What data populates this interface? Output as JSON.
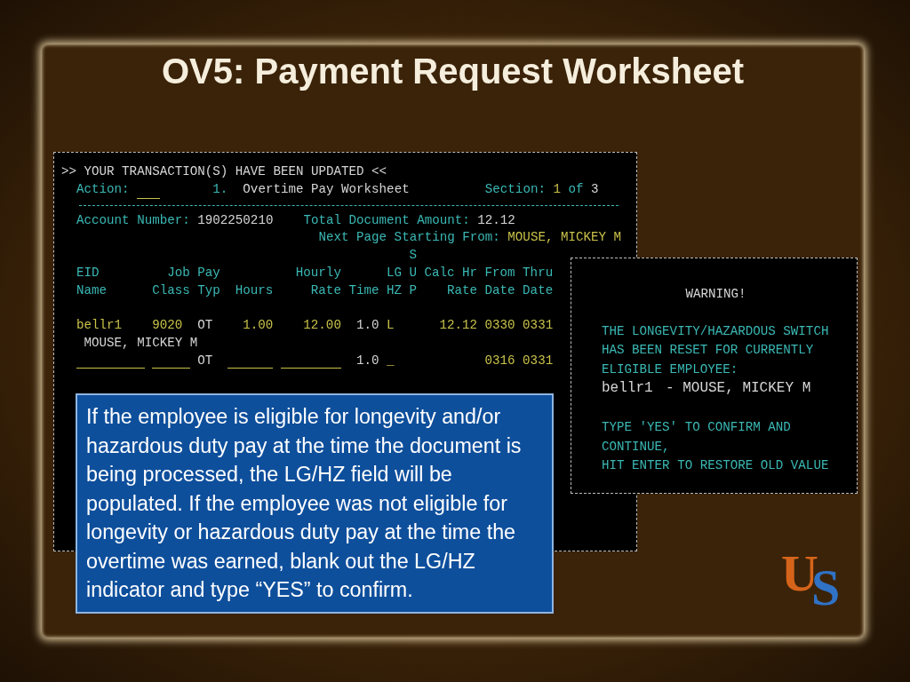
{
  "title": "OV5: Payment Request Worksheet",
  "terminal": {
    "banner": ">> YOUR TRANSACTION(S) HAVE BEEN UPDATED <<",
    "action": {
      "label": "Action:",
      "number": "1.",
      "screen": "Overtime Pay Worksheet",
      "section_label": "Section:",
      "section_current": "1",
      "section_of": "of",
      "section_total": "3"
    },
    "account": {
      "label": "Account Number:",
      "value": "1902250210"
    },
    "total": {
      "label": "Total Document Amount:",
      "value": "12.12"
    },
    "next_page": {
      "label": "Next Page Starting From:",
      "value": "MOUSE, MICKEY M"
    },
    "columns": [
      {
        "line_2": "EID",
        "line_3": "Name"
      },
      {
        "line_2": "Job",
        "line_3": "Class"
      },
      {
        "line_2": "Pay",
        "line_3": "Typ"
      },
      {
        "line_3": "Hours"
      },
      {
        "line_2": "Hourly",
        "line_3": "Rate"
      },
      {
        "line_3": "Time"
      },
      {
        "line_2": "LG",
        "line_3": "HZ"
      },
      {
        "line_1": "S",
        "line_2": "U",
        "line_3": "P"
      },
      {
        "line_2": "Calc Hr",
        "line_3": "Rate"
      },
      {
        "line_2": "From",
        "line_3": "Date"
      },
      {
        "line_2": "Thru",
        "line_3": "Date"
      }
    ],
    "rows": [
      {
        "cells": [
          {
            "kind": "input",
            "text": "bellr1"
          },
          {
            "kind": "input",
            "text": "9020"
          },
          {
            "kind": "value",
            "text": "OT"
          },
          {
            "kind": "input",
            "text": "1.00"
          },
          {
            "kind": "input",
            "text": "12.00"
          },
          {
            "kind": "value",
            "text": "1.0"
          },
          {
            "kind": "input",
            "text": "L"
          },
          {
            "kind": "blank"
          },
          {
            "kind": "input",
            "text": "12.12"
          },
          {
            "kind": "input",
            "text": "0330"
          },
          {
            "kind": "input",
            "text": "0331"
          }
        ],
        "name": "MOUSE, MICKEY M"
      },
      {
        "cells": [
          {
            "kind": "input"
          },
          {
            "kind": "input"
          },
          {
            "kind": "value",
            "text": "OT"
          },
          {
            "kind": "input"
          },
          {
            "kind": "input"
          },
          {
            "kind": "value",
            "text": "1.0"
          },
          {
            "kind": "input",
            "text": "_"
          },
          {
            "kind": "blank"
          },
          {
            "kind": "blank"
          },
          {
            "kind": "input",
            "text": "0316"
          },
          {
            "kind": "input",
            "text": "0331"
          }
        ]
      }
    ]
  },
  "warning": {
    "title": "WARNING!",
    "message": [
      "THE LONGEVITY/HAZARDOUS SWITCH",
      "HAS BEEN RESET FOR CURRENTLY",
      "ELIGIBLE EMPLOYEE:"
    ],
    "employee_id": "bellr1",
    "employee_name": "- MOUSE, MICKEY M",
    "instructions": [
      "TYPE 'YES' TO CONFIRM AND",
      "CONTINUE,",
      "HIT ENTER TO RESTORE OLD VALUE"
    ]
  },
  "callout": "If the employee is eligible for longevity and/or hazardous duty pay at the time the document is being processed, the LG/HZ field will be populated. If the employee was not eligible for longevity or hazardous duty pay at the time the overtime was earned, blank out the LG/HZ indicator and type “YES” to confirm.",
  "logo": {
    "letters": [
      "U",
      "S"
    ]
  }
}
